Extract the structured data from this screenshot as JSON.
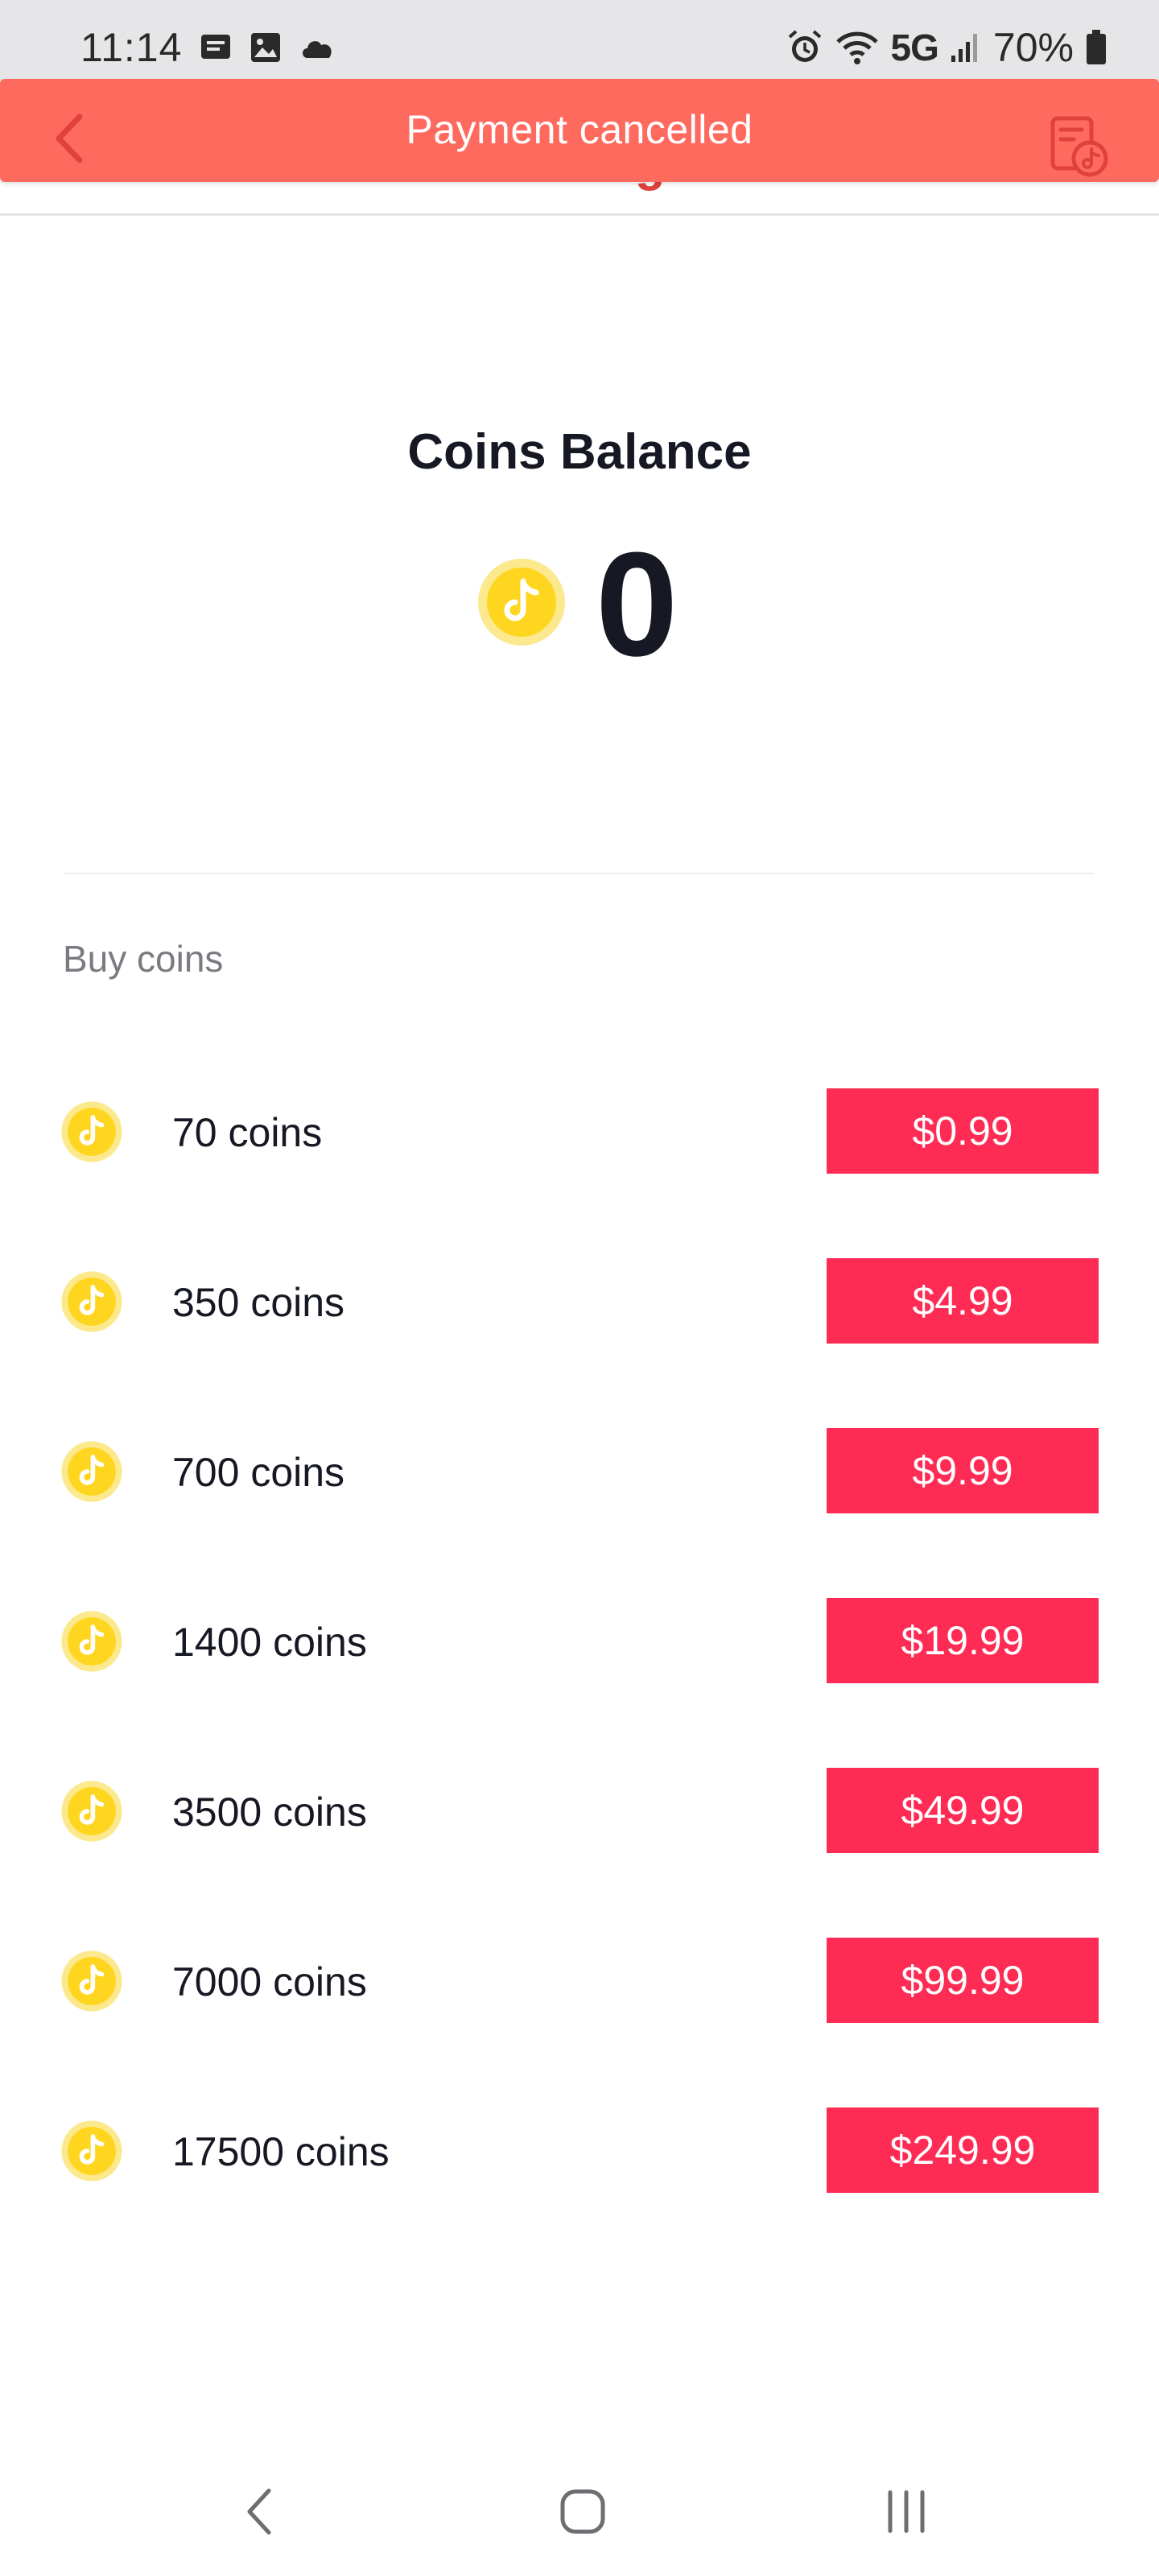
{
  "status_bar": {
    "time": "11:14",
    "left_icons": [
      "message-icon",
      "image-icon",
      "cloud-icon"
    ],
    "right_icons": [
      "alarm-icon",
      "wifi-icon",
      "signal-icon",
      "battery-icon"
    ],
    "network": "5G",
    "battery": "70%"
  },
  "header": {
    "title": "Recharge",
    "toast": "Payment cancelled",
    "back_icon": "chevron-left-icon",
    "history_icon": "transaction-history-icon"
  },
  "balance": {
    "title": "Coins Balance",
    "value": "0"
  },
  "buy_section": {
    "label": "Buy coins",
    "packages": [
      {
        "label": "70 coins",
        "price": "$0.99"
      },
      {
        "label": "350 coins",
        "price": "$4.99"
      },
      {
        "label": "700 coins",
        "price": "$9.99"
      },
      {
        "label": "1400 coins",
        "price": "$19.99"
      },
      {
        "label": "3500 coins",
        "price": "$49.99"
      },
      {
        "label": "7000 coins",
        "price": "$99.99"
      },
      {
        "label": "17500 coins",
        "price": "$249.99"
      }
    ]
  },
  "nav_bar": {
    "items": [
      "back-icon",
      "home-icon",
      "recent-apps-icon"
    ]
  },
  "colors": {
    "accent": "#fe2c55",
    "toast": "#ff6a5f",
    "coin": "#ffd61f",
    "coin_ring": "#fce98d",
    "text": "#161823"
  }
}
